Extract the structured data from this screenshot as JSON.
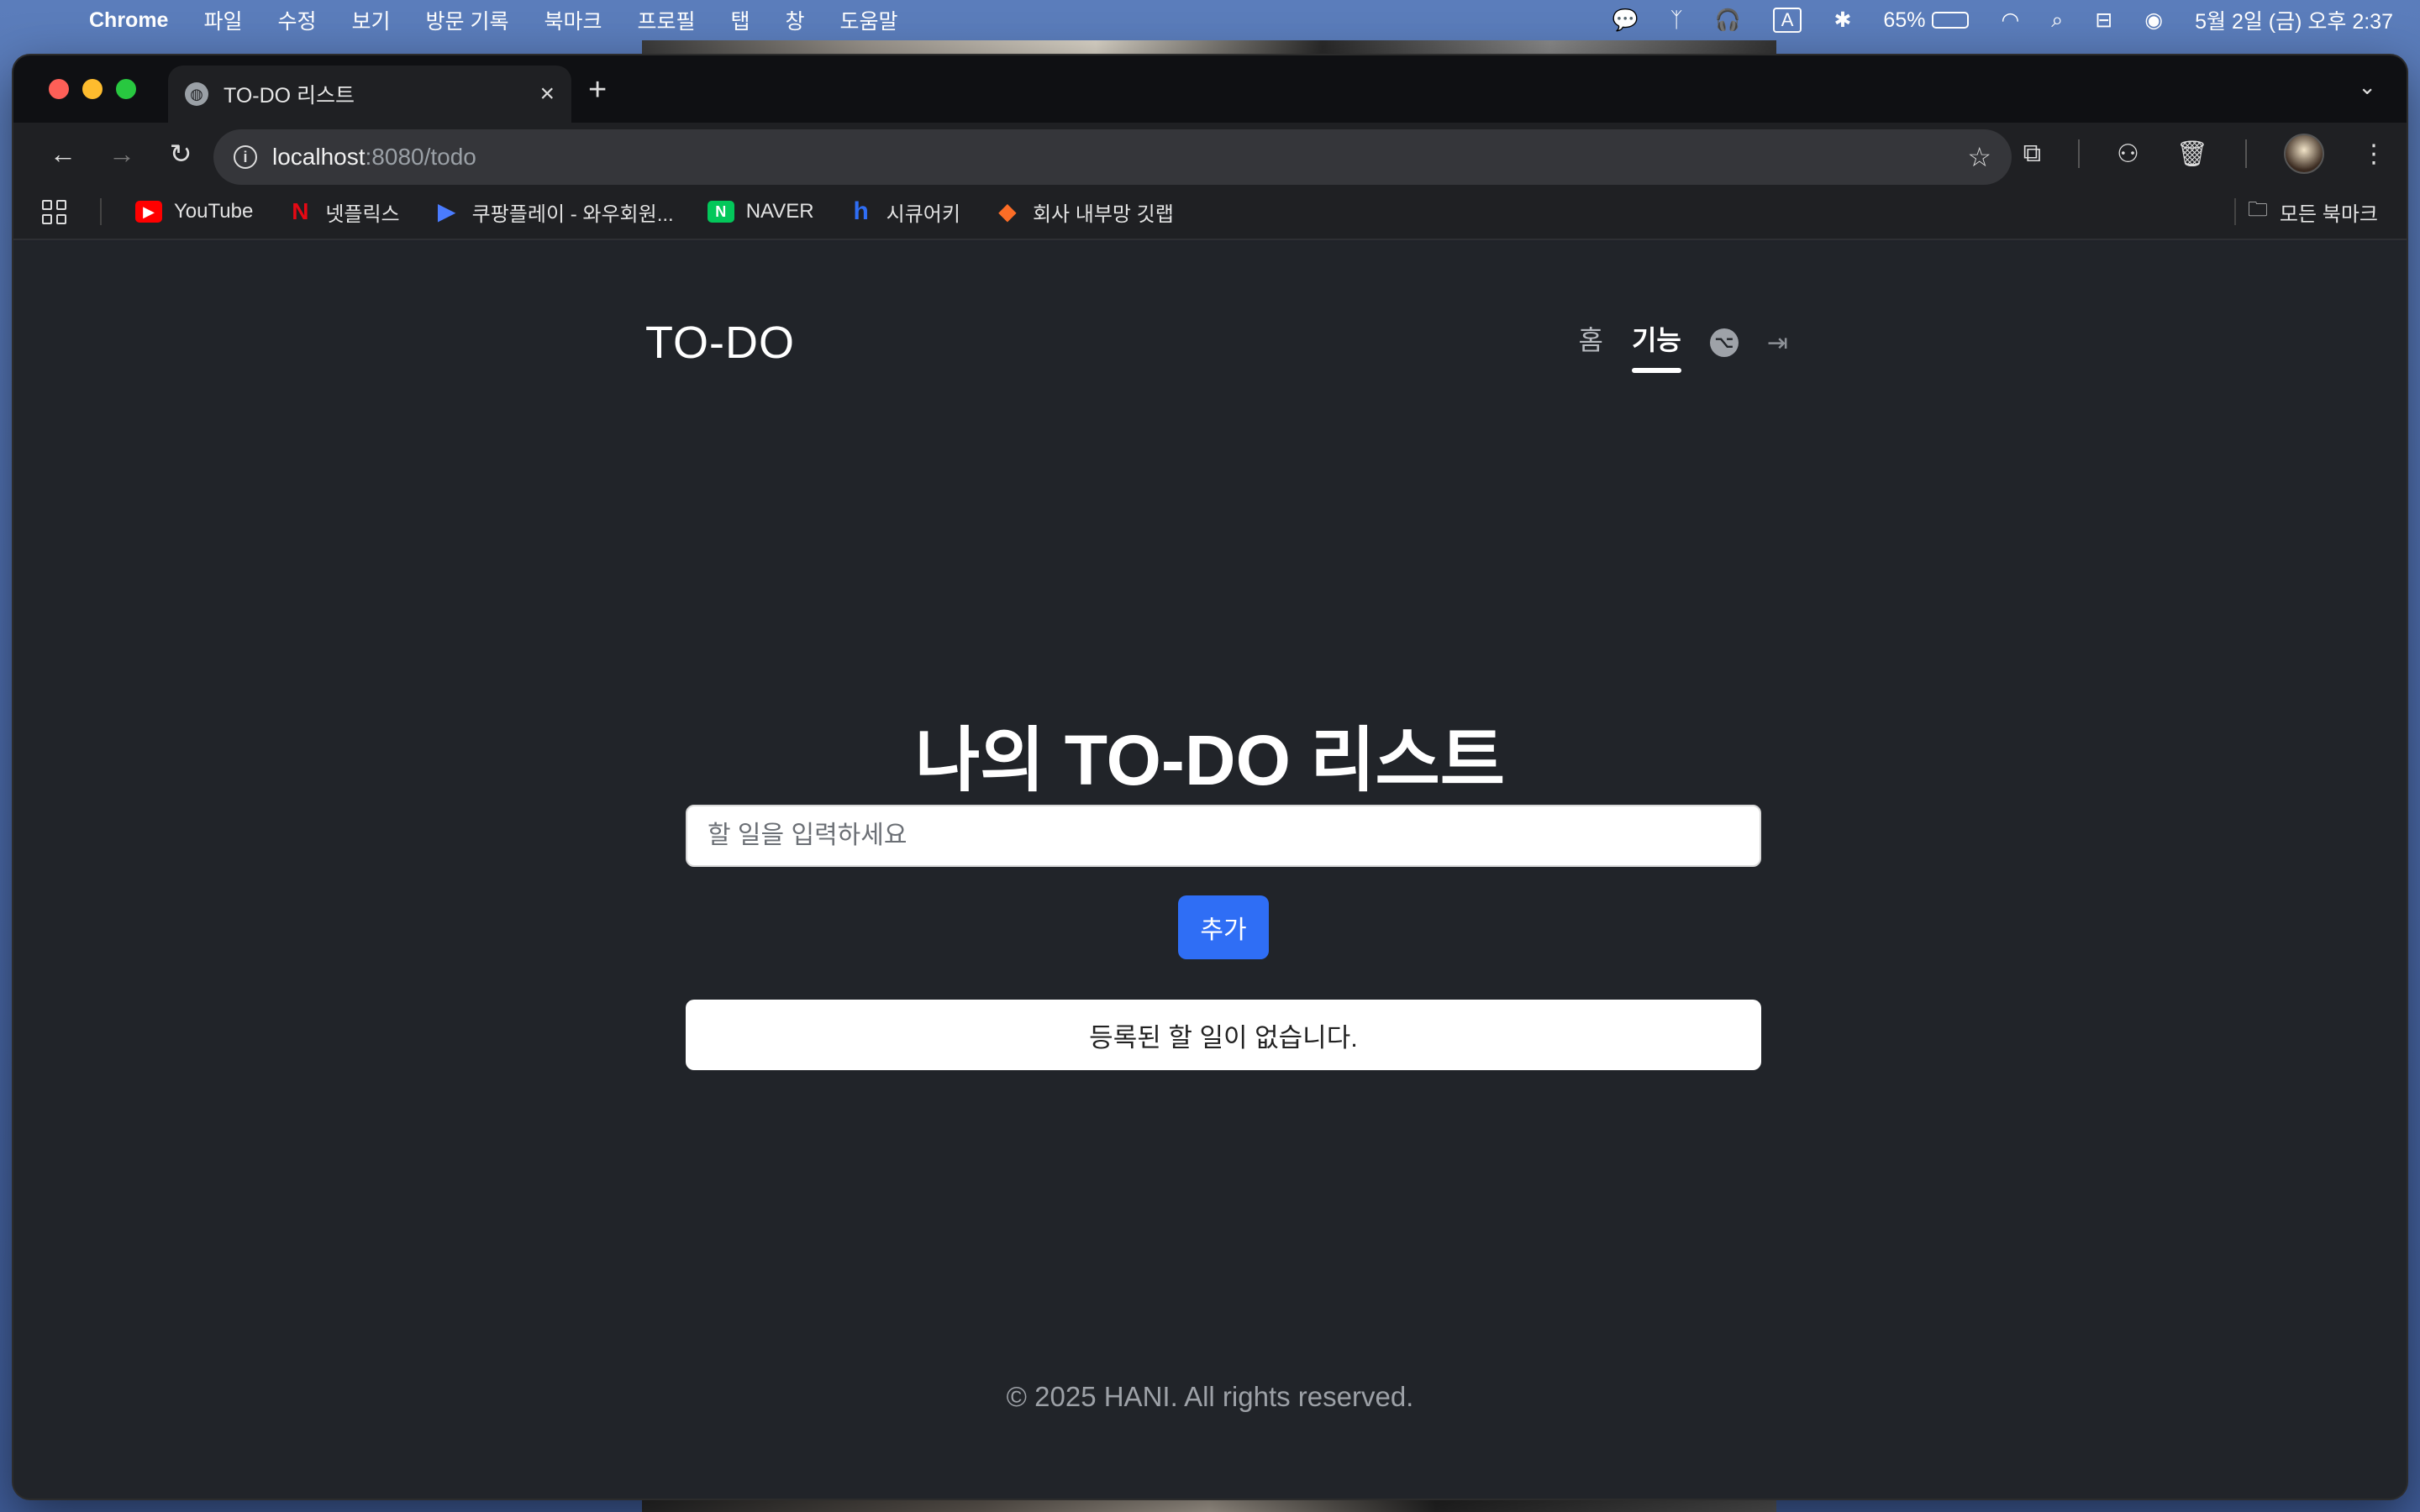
{
  "menubar": {
    "app_name": "Chrome",
    "items": [
      "파일",
      "수정",
      "보기",
      "방문 기록",
      "북마크",
      "프로필",
      "탭",
      "창",
      "도움말"
    ],
    "input_source": "A",
    "battery": "65%",
    "battery_level": 0.65,
    "datetime": "5월 2일 (금) 오후 2:37"
  },
  "browser": {
    "tab_title": "TO-DO 리스트",
    "url_host": "localhost",
    "url_rest": ":8080/todo",
    "bookmarks": [
      {
        "label": "YouTube",
        "icon": "youtube-icon",
        "color": "#ff0000"
      },
      {
        "label": "넷플릭스",
        "icon": "netflix-icon",
        "color": "#e50914"
      },
      {
        "label": "쿠팡플레이 - 와우회원...",
        "icon": "coupang-play-icon",
        "color": "#4a7cff"
      },
      {
        "label": "NAVER",
        "icon": "naver-icon",
        "color": "#03c75a"
      },
      {
        "label": "시큐어키",
        "icon": "securekey-icon",
        "color": "#2f6ef5"
      },
      {
        "label": "회사 내부망 깃랩",
        "icon": "gitlab-icon",
        "color": "#fc6d26"
      }
    ],
    "all_bookmarks": "모든 북마크"
  },
  "site": {
    "logo": "TO-DO",
    "nav": {
      "home": "홈",
      "features": "기능"
    },
    "title": "나의 TO-DO 리스트",
    "input_placeholder": "할 일을 입력하세요",
    "add_button": "추가",
    "empty_message": "등록된 할 일이 없습니다.",
    "footer": "© 2025 HANI. All rights reserved.",
    "accent_color": "#2f6ef5"
  }
}
